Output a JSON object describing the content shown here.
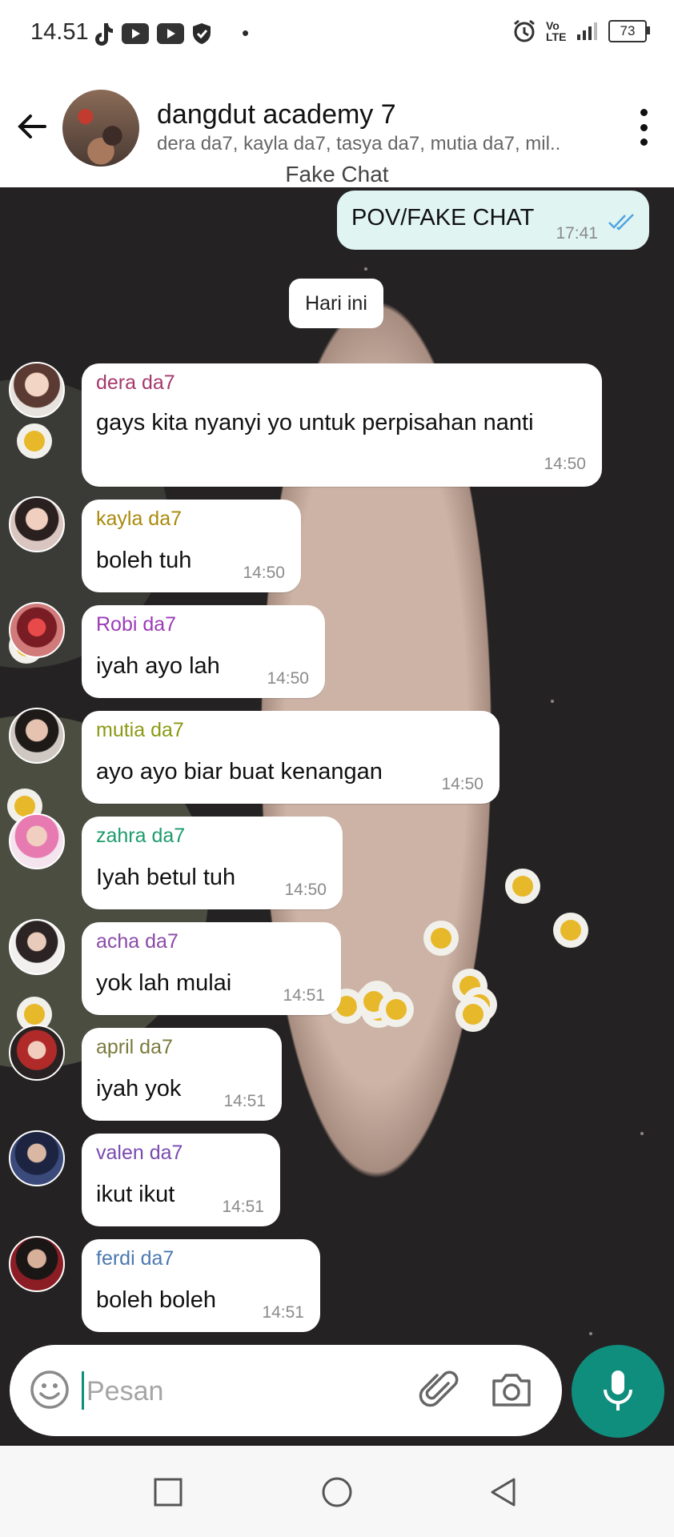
{
  "status_bar": {
    "time": "14.51",
    "dot": "•",
    "network": "Vo LTE",
    "battery": "73",
    "icons": [
      "tiktok-icon",
      "youtube-icon",
      "youtube-icon",
      "shield-icon",
      "alarm-icon",
      "signal-icon",
      "battery-icon"
    ]
  },
  "header": {
    "title": "dangdut academy 7",
    "members": "dera da7, kayla da7, tasya da7, mutia da7, mil..",
    "subtitle": "Fake Chat"
  },
  "sent_message": {
    "text": "POV/FAKE CHAT",
    "time": "17:41"
  },
  "date_chip": "Hari ini",
  "messages": [
    {
      "sender": "dera da7",
      "text": "gays kita nyanyi yo untuk perpisahan nanti",
      "time": "14:50",
      "color": "#a43a6c"
    },
    {
      "sender": "kayla da7",
      "text": "boleh tuh",
      "time": "14:50",
      "color": "#a98a0c"
    },
    {
      "sender": "Robi da7",
      "text": "iyah ayo lah",
      "time": "14:50",
      "color": "#9b3bb8"
    },
    {
      "sender": "mutia da7",
      "text": "ayo ayo biar buat kenangan",
      "time": "14:50",
      "color": "#8a9a14"
    },
    {
      "sender": "zahra da7",
      "text": "Iyah betul tuh",
      "time": "14:50",
      "color": "#1e9b6c"
    },
    {
      "sender": "acha da7",
      "text": "yok lah mulai",
      "time": "14:51",
      "color": "#8a4aa8"
    },
    {
      "sender": "april da7",
      "text": "iyah yok",
      "time": "14:51",
      "color": "#7a7a3c"
    },
    {
      "sender": "valen da7",
      "text": "ikut ikut",
      "time": "14:51",
      "color": "#7a4ab0"
    },
    {
      "sender": "ferdi da7",
      "text": "boleh boleh",
      "time": "14:51",
      "color": "#4a79b0"
    }
  ],
  "composer": {
    "placeholder": "Pesan",
    "value": ""
  },
  "colors": {
    "accent": "#0f8e7e",
    "sent_bubble": "#e0f5f2",
    "read_tick": "#4fa3e0"
  }
}
